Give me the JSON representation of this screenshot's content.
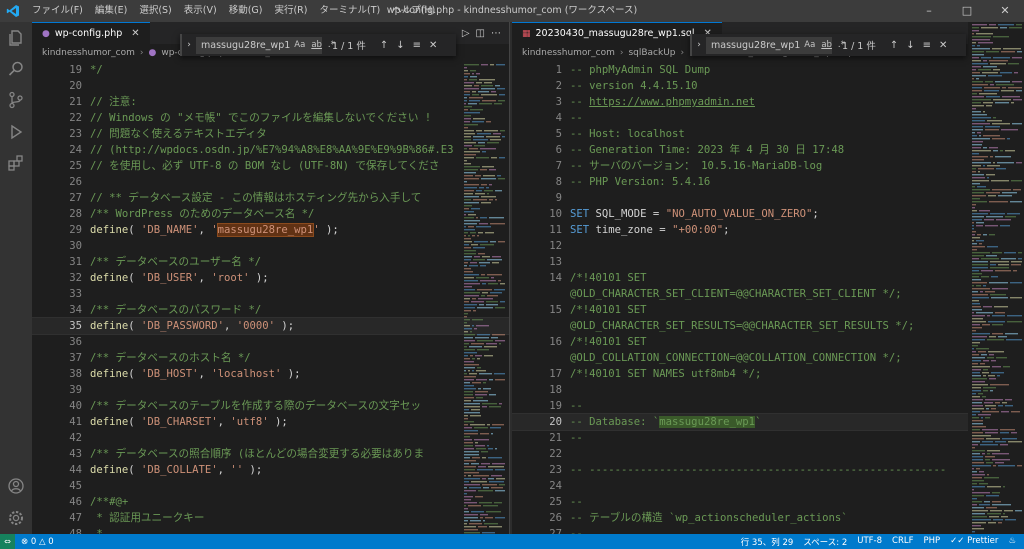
{
  "titlebar": {
    "menu": [
      "ファイル(F)",
      "編集(E)",
      "選択(S)",
      "表示(V)",
      "移動(G)",
      "実行(R)",
      "ターミナル(T)",
      "ヘルプ(H)"
    ],
    "title": "wp-config.php - kindnesshumor_com (ワークスペース)"
  },
  "left": {
    "tab": "wp-config.php",
    "breadcrumb": [
      "kindnesshumor_com",
      "wp-config.php",
      "DB_PASSWORD"
    ],
    "find": {
      "value": "massugu28re_wp1",
      "opt_case": "Aa",
      "opt_word": "ab",
      "opt_regex": ".*",
      "count": "1 / 1 件"
    },
    "lines": [
      {
        "n": "19",
        "t": [
          [
            "c-com",
            "*/"
          ]
        ]
      },
      {
        "n": "20",
        "t": []
      },
      {
        "n": "21",
        "t": [
          [
            "c-com",
            "// 注意:"
          ]
        ]
      },
      {
        "n": "22",
        "t": [
          [
            "c-com",
            "// Windows の \"メモ帳\" でこのファイルを編集しないでください !"
          ]
        ]
      },
      {
        "n": "23",
        "t": [
          [
            "c-com",
            "// 問題なく使えるテキストエディタ"
          ]
        ]
      },
      {
        "n": "24",
        "t": [
          [
            "c-com",
            "// (http://wpdocs.osdn.jp/%E7%94%A8%E8%AA%9E%E9%9B%86#.E3"
          ]
        ]
      },
      {
        "n": "25",
        "t": [
          [
            "c-com",
            "// を使用し、必ず UTF-8 の BOM なし (UTF-8N) で保存してくださ"
          ]
        ]
      },
      {
        "n": "26",
        "t": []
      },
      {
        "n": "27",
        "t": [
          [
            "c-com",
            "// ** データベース設定 - この情報はホスティング先から入手して"
          ]
        ]
      },
      {
        "n": "28",
        "t": [
          [
            "c-com",
            "/** WordPress のためのデータベース名 */"
          ]
        ]
      },
      {
        "n": "29",
        "t": [
          [
            "c-fn",
            "define"
          ],
          [
            "c-plain",
            "( "
          ],
          [
            "c-str",
            "'DB_NAME'"
          ],
          [
            "c-plain",
            ", "
          ],
          [
            "c-str",
            "'"
          ],
          [
            "c-str hl-find",
            "massugu28re_wp1"
          ],
          [
            "c-str",
            "'"
          ],
          [
            "c-plain",
            " );"
          ]
        ]
      },
      {
        "n": "30",
        "t": []
      },
      {
        "n": "31",
        "t": [
          [
            "c-com",
            "/** データベースのユーザー名 */"
          ]
        ]
      },
      {
        "n": "32",
        "t": [
          [
            "c-fn",
            "define"
          ],
          [
            "c-plain",
            "( "
          ],
          [
            "c-str",
            "'DB_USER'"
          ],
          [
            "c-plain",
            ", "
          ],
          [
            "c-str",
            "'root'"
          ],
          [
            "c-plain",
            " );"
          ]
        ]
      },
      {
        "n": "33",
        "t": []
      },
      {
        "n": "34",
        "t": [
          [
            "c-com",
            "/** データベースのパスワード */"
          ]
        ]
      },
      {
        "n": "35",
        "t": [
          [
            "c-fn",
            "define"
          ],
          [
            "c-plain",
            "( "
          ],
          [
            "c-str",
            "'DB_PASSWORD'"
          ],
          [
            "c-plain",
            ", "
          ],
          [
            "c-str",
            "'0000'"
          ],
          [
            "c-plain",
            " );"
          ]
        ],
        "current": true
      },
      {
        "n": "36",
        "t": []
      },
      {
        "n": "37",
        "t": [
          [
            "c-com",
            "/** データベースのホスト名 */"
          ]
        ]
      },
      {
        "n": "38",
        "t": [
          [
            "c-fn",
            "define"
          ],
          [
            "c-plain",
            "( "
          ],
          [
            "c-str",
            "'DB_HOST'"
          ],
          [
            "c-plain",
            ", "
          ],
          [
            "c-str",
            "'localhost'"
          ],
          [
            "c-plain",
            " );"
          ]
        ]
      },
      {
        "n": "39",
        "t": []
      },
      {
        "n": "40",
        "t": [
          [
            "c-com",
            "/** データベースのテーブルを作成する際のデータベースの文字セッ"
          ]
        ]
      },
      {
        "n": "41",
        "t": [
          [
            "c-fn",
            "define"
          ],
          [
            "c-plain",
            "( "
          ],
          [
            "c-str",
            "'DB_CHARSET'"
          ],
          [
            "c-plain",
            ", "
          ],
          [
            "c-str",
            "'utf8'"
          ],
          [
            "c-plain",
            " );"
          ]
        ]
      },
      {
        "n": "42",
        "t": []
      },
      {
        "n": "43",
        "t": [
          [
            "c-com",
            "/** データベースの照合順序 (ほとんどの場合変更する必要はありま"
          ]
        ]
      },
      {
        "n": "44",
        "t": [
          [
            "c-fn",
            "define"
          ],
          [
            "c-plain",
            "( "
          ],
          [
            "c-str",
            "'DB_COLLATE'"
          ],
          [
            "c-plain",
            ", "
          ],
          [
            "c-str",
            "''"
          ],
          [
            "c-plain",
            " );"
          ]
        ]
      },
      {
        "n": "45",
        "t": []
      },
      {
        "n": "46",
        "t": [
          [
            "c-com",
            "/**#@+"
          ]
        ]
      },
      {
        "n": "47",
        "t": [
          [
            "c-com",
            " * 認証用ユニークキー"
          ]
        ]
      },
      {
        "n": "48",
        "t": [
          [
            "c-com",
            " *"
          ]
        ]
      }
    ]
  },
  "right": {
    "tab": "20230430_massugu28re_wp1.sql",
    "breadcrumb": [
      "kindnesshumor_com",
      "sqlBackUp",
      "20230430_massugu28re_wp1.sql"
    ],
    "find": {
      "value": "massugu28re_wp1",
      "opt_case": "Aa",
      "opt_word": "ab",
      "opt_regex": ".*",
      "count": "1 / 1 件"
    },
    "lines": [
      {
        "n": "1",
        "t": [
          [
            "c-com",
            "-- phpMyAdmin SQL Dump"
          ]
        ]
      },
      {
        "n": "2",
        "t": [
          [
            "c-com",
            "-- version 4.4.15.10"
          ]
        ]
      },
      {
        "n": "3",
        "t": [
          [
            "c-com",
            "-- "
          ],
          [
            "c-link",
            "https://www.phpmyadmin.net"
          ]
        ]
      },
      {
        "n": "4",
        "t": [
          [
            "c-com",
            "--"
          ]
        ]
      },
      {
        "n": "5",
        "t": [
          [
            "c-com",
            "-- Host: localhost"
          ]
        ]
      },
      {
        "n": "6",
        "t": [
          [
            "c-com",
            "-- Generation Time: 2023 年 4 月 30 日 17:48"
          ]
        ]
      },
      {
        "n": "7",
        "t": [
          [
            "c-com",
            "-- サーバのバージョン： 10.5.16-MariaDB-log"
          ]
        ]
      },
      {
        "n": "8",
        "t": [
          [
            "c-com",
            "-- PHP Version: 5.4.16"
          ]
        ]
      },
      {
        "n": "9",
        "t": []
      },
      {
        "n": "10",
        "t": [
          [
            "c-kw",
            "SET"
          ],
          [
            "c-plain",
            " SQL_MODE = "
          ],
          [
            "c-str",
            "\"NO_AUTO_VALUE_ON_ZERO\""
          ],
          [
            "c-plain",
            ";"
          ]
        ]
      },
      {
        "n": "11",
        "t": [
          [
            "c-kw",
            "SET"
          ],
          [
            "c-plain",
            " time_zone = "
          ],
          [
            "c-str",
            "\"+00:00\""
          ],
          [
            "c-plain",
            ";"
          ]
        ]
      },
      {
        "n": "12",
        "t": []
      },
      {
        "n": "13",
        "t": []
      },
      {
        "n": "14",
        "t": [
          [
            "c-com",
            "/*!40101 SET"
          ]
        ]
      },
      {
        "n": "",
        "t": [
          [
            "c-com",
            "@OLD_CHARACTER_SET_CLIENT=@@CHARACTER_SET_CLIENT */;"
          ]
        ]
      },
      {
        "n": "15",
        "t": [
          [
            "c-com",
            "/*!40101 SET"
          ]
        ]
      },
      {
        "n": "",
        "t": [
          [
            "c-com",
            "@OLD_CHARACTER_SET_RESULTS=@@CHARACTER_SET_RESULTS */;"
          ]
        ]
      },
      {
        "n": "16",
        "t": [
          [
            "c-com",
            "/*!40101 SET"
          ]
        ]
      },
      {
        "n": "",
        "t": [
          [
            "c-com",
            "@OLD_COLLATION_CONNECTION=@@COLLATION_CONNECTION */;"
          ]
        ]
      },
      {
        "n": "17",
        "t": [
          [
            "c-com",
            "/*!40101 SET NAMES utf8mb4 */;"
          ]
        ]
      },
      {
        "n": "18",
        "t": []
      },
      {
        "n": "19",
        "t": [
          [
            "c-com",
            "--"
          ]
        ]
      },
      {
        "n": "20",
        "t": [
          [
            "c-com",
            "-- Database: `"
          ],
          [
            "c-com hl-match",
            "massugu28re_wp1"
          ],
          [
            "c-com",
            "`"
          ]
        ],
        "current": true
      },
      {
        "n": "21",
        "t": [
          [
            "c-com",
            "--"
          ]
        ]
      },
      {
        "n": "22",
        "t": []
      },
      {
        "n": "23",
        "t": [
          [
            "c-com",
            "-- --------------------------------------------------------"
          ]
        ]
      },
      {
        "n": "24",
        "t": []
      },
      {
        "n": "25",
        "t": [
          [
            "c-com",
            "--"
          ]
        ]
      },
      {
        "n": "26",
        "t": [
          [
            "c-com",
            "-- テーブルの構造 `wp_actionscheduler_actions`"
          ]
        ]
      },
      {
        "n": "27",
        "t": [
          [
            "c-com",
            "--"
          ]
        ]
      }
    ]
  },
  "statusbar": {
    "errors": "0",
    "warnings": "0",
    "position": "行 35、列 29",
    "spaces": "スペース: 2",
    "encoding": "UTF-8",
    "eol": "CRLF",
    "language": "PHP",
    "prettier": "Prettier"
  },
  "colors": {
    "accent": "#007acc",
    "comment": "#6a9955",
    "string": "#ce9178",
    "function": "#dcdcaa",
    "keyword": "#569cd6"
  }
}
